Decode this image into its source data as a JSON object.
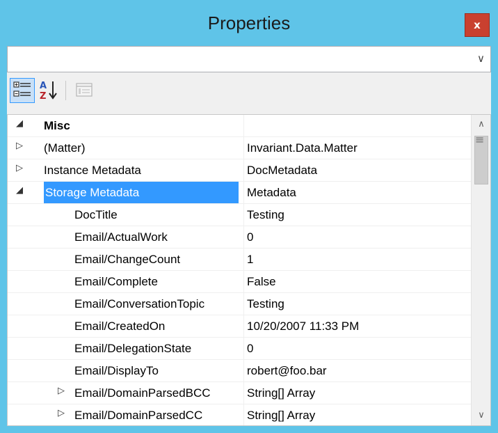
{
  "window": {
    "title": "Properties",
    "close_label": "x"
  },
  "selector": {
    "value": "",
    "chevron_glyph": "∨"
  },
  "toolbar": {
    "categorized_icon": "categorized-icon",
    "alphabetical_icon": "sort-alphabetical-icon",
    "alphabetical_glyph": "A\nZ",
    "property_pages_icon": "property-pages-icon"
  },
  "grid": {
    "rows": [
      {
        "glyph": "◢",
        "name": "Misc",
        "value": ""
      },
      {
        "glyph": "▷",
        "name": "(Matter)",
        "value": "Invariant.Data.Matter"
      },
      {
        "glyph": "▷",
        "name": "Instance Metadata",
        "value": "DocMetadata"
      },
      {
        "glyph": "◢",
        "name": "Storage Metadata",
        "value": "Metadata"
      },
      {
        "glyph": "",
        "name": "DocTitle",
        "value": "Testing"
      },
      {
        "glyph": "",
        "name": "Email/ActualWork",
        "value": "0"
      },
      {
        "glyph": "",
        "name": "Email/ChangeCount",
        "value": "1"
      },
      {
        "glyph": "",
        "name": "Email/Complete",
        "value": "False"
      },
      {
        "glyph": "",
        "name": "Email/ConversationTopic",
        "value": "Testing"
      },
      {
        "glyph": "",
        "name": "Email/CreatedOn",
        "value": "10/20/2007 11:33 PM"
      },
      {
        "glyph": "",
        "name": "Email/DelegationState",
        "value": "0"
      },
      {
        "glyph": "",
        "name": "Email/DisplayTo",
        "value": "robert@foo.bar"
      },
      {
        "glyph": "▷",
        "name": "Email/DomainParsedBCC",
        "value": "String[] Array"
      },
      {
        "glyph": "▷",
        "name": "Email/DomainParsedCC",
        "value": "String[] Array"
      }
    ]
  },
  "scrollbar": {
    "up_glyph": "∧",
    "down_glyph": "∨",
    "grip_glyph": "≡"
  },
  "colors": {
    "titlebar": "#5fc4e8",
    "selection": "#3399ff",
    "close": "#c9402f"
  }
}
